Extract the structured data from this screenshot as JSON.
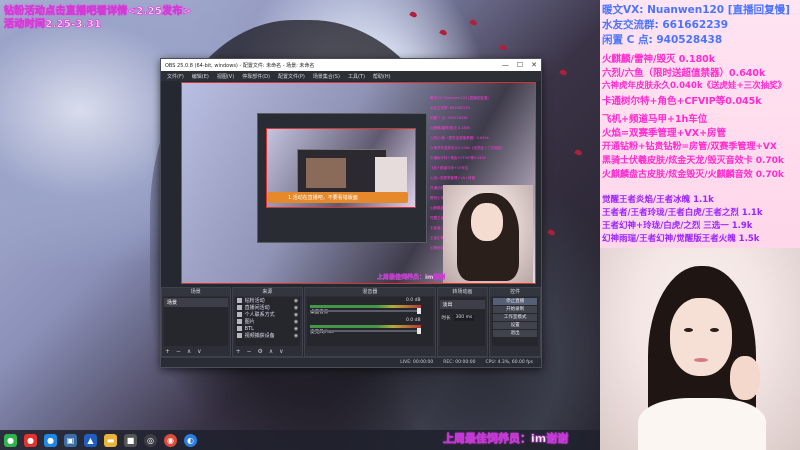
{
  "overlay": {
    "line1": "钻粉活动点击直播吧看详情<2.25发布>",
    "line2": "活动时间2.25-3.31"
  },
  "obs": {
    "title": "OBS 25.0.8 (64-bit, windows) - 配置文件: 未命名 - 场景: 未命名",
    "window_buttons": [
      "—",
      "☐",
      "✕"
    ],
    "menu": [
      "文件(F)",
      "编辑(E)",
      "视图(V)",
      "停靠部件(D)",
      "配置文件(P)",
      "场景集合(S)",
      "工具(T)",
      "帮助(H)"
    ],
    "preview_caption": "上周最佳饲养员：im谢谢",
    "nested_banner": "1.活动在直播吧，不要看错版面",
    "docks": {
      "scenes": {
        "title": "场景",
        "items": [
          "场景"
        ]
      },
      "sources": {
        "title": "来源",
        "items": [
          "钻粉活动",
          "直播间活动",
          "个人联系方式",
          "图片",
          "BTL",
          "视频捕获设备"
        ]
      },
      "mixer": {
        "title": "混音器",
        "tracks": [
          {
            "name": "桌面音频",
            "level": "0.0 dB"
          },
          {
            "name": "麦克风/Aux",
            "level": "0.0 dB"
          }
        ]
      },
      "transitions": {
        "title": "转场动画",
        "type": "淡出",
        "duration_label": "时长",
        "duration": "300 ms"
      },
      "controls": {
        "title": "控件",
        "buttons": [
          "停止直播",
          "开始录制",
          "工作室模式",
          "设置",
          "退出"
        ]
      }
    },
    "status": {
      "live": "LIVE: 00:00:00",
      "rec": "REC: 00:00:00",
      "cpu": "CPU: 4.3%, 60.00 fps"
    }
  },
  "right_panel": {
    "contacts": [
      {
        "text": "暖文VX: Nuanwen120 [直播回复慢]",
        "color": "#4a74ff"
      },
      {
        "text": "水友交流群: 661662239",
        "color": "#4a74ff"
      },
      {
        "text": "闲置 C 点: 940528438",
        "color": "#4a74ff"
      }
    ],
    "prices": [
      "火麒麟/雷神/毁灭 0.180k",
      "六烈/六鱼（限时送超值禁器）0.640k",
      "六神虎年皮肤永久0.040k《送虎娃+三次抽奖》",
      "卡通树尔特+角色+CFVIP等0.045k"
    ],
    "services": [
      "飞机+频道马甲+1h车位",
      "火焰=双赛季管理+VX+房管",
      "开通钻粉+钻贵钻粉=房管/双赛季管理+VX",
      "黑骑士伏羲皮肤/炫金天龙/毁灭音效卡 0.70k",
      "火麒麟盘古皮肤/炫金毁灭/火麒麟音效 0.70k"
    ],
    "games": [
      "觉醒王者炎焰/王者冰魄 1.1k",
      "王者者/王者玲珑/王者白虎/王者之烈 1.1k",
      "王者幻神+玲珑/白虎/之烈 三选一 1.9k",
      "幻神雨瑞/王者幻神/觉醒版王者火魄 1.5k"
    ]
  },
  "taskbar": {
    "icons": [
      "wechat-icon",
      "weibo-icon",
      "qq-icon",
      "monitor-icon",
      "stream-icon",
      "folder-icon",
      "app-icon",
      "obs-icon",
      "chrome-icon",
      "edge-icon"
    ]
  },
  "bottom_caption": "上周最佳饲养员：im谢谢"
}
